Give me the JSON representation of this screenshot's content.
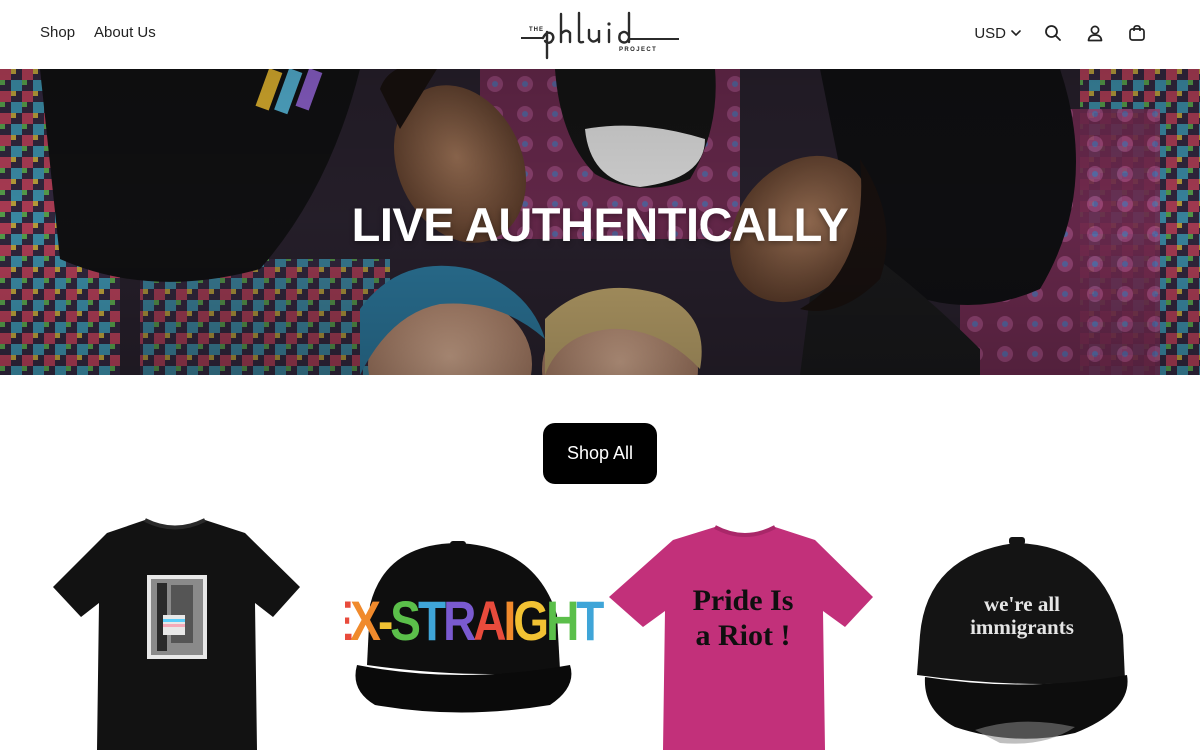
{
  "header": {
    "nav": [
      {
        "label": "Shop"
      },
      {
        "label": "About Us"
      }
    ],
    "logo": {
      "small_top": "THE",
      "wordmark": "phluid",
      "small_bottom": "PROJECT"
    },
    "currency": "USD",
    "icons": [
      "search-icon",
      "account-icon",
      "cart-icon"
    ]
  },
  "hero": {
    "title": "LIVE AUTHENTICALLY"
  },
  "cta": {
    "label": "Shop All"
  },
  "products": [
    {
      "name": "tee-black-photo",
      "print": ""
    },
    {
      "name": "trucker-hat-ex-straight",
      "print": "EX-STRAIGHT"
    },
    {
      "name": "tee-pink-pride-is-a-riot",
      "print_line1": "Pride Is",
      "print_line2": "a Riot !"
    },
    {
      "name": "cap-were-all-immigrants",
      "print_line1": "we're all",
      "print_line2": "immigrants"
    }
  ],
  "colors": {
    "brand_black": "#000000",
    "tee_pink": "#c2307a",
    "text": "#222222"
  }
}
